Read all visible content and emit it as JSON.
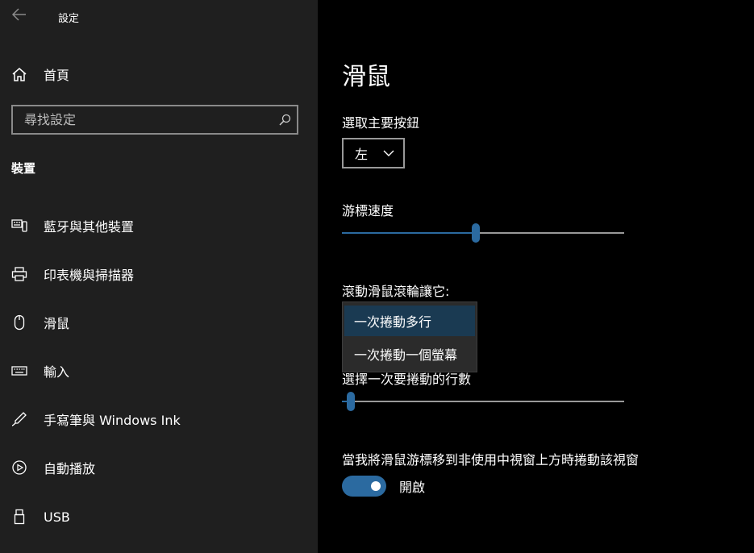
{
  "window": {
    "title": "設定"
  },
  "sidebar": {
    "home_label": "首頁",
    "search_placeholder": "尋找設定",
    "section_title": "裝置",
    "items": [
      {
        "label": "藍牙與其他裝置",
        "icon": "bluetooth-devices-icon"
      },
      {
        "label": "印表機與掃描器",
        "icon": "printer-icon"
      },
      {
        "label": "滑鼠",
        "icon": "mouse-icon"
      },
      {
        "label": "輸入",
        "icon": "keyboard-icon"
      },
      {
        "label": "手寫筆與 Windows Ink",
        "icon": "pen-icon"
      },
      {
        "label": "自動播放",
        "icon": "autoplay-icon"
      },
      {
        "label": "USB",
        "icon": "usb-icon"
      }
    ]
  },
  "main": {
    "title": "滑鼠",
    "primary_button": {
      "label": "選取主要按鈕",
      "value": "左"
    },
    "cursor_speed": {
      "label": "游標速度",
      "value_fraction": 0.475
    },
    "scroll": {
      "label": "滾動滑鼠滾輪讓它:",
      "options": [
        "一次捲動多行",
        "一次捲動一個螢幕"
      ],
      "selected": "一次捲動多行"
    },
    "lines_to_scroll": {
      "label": "選擇一次要捲動的行數",
      "value_fraction": 0.03
    },
    "inactive_scroll": {
      "label": "當我將滑鼠游標移到非使用中視窗上方時捲動該視窗",
      "state_label": "開啟",
      "on": true
    }
  },
  "colors": {
    "accent": "#2b6aa0",
    "sidebar_bg": "#1f1f1f",
    "main_bg": "#000000"
  }
}
